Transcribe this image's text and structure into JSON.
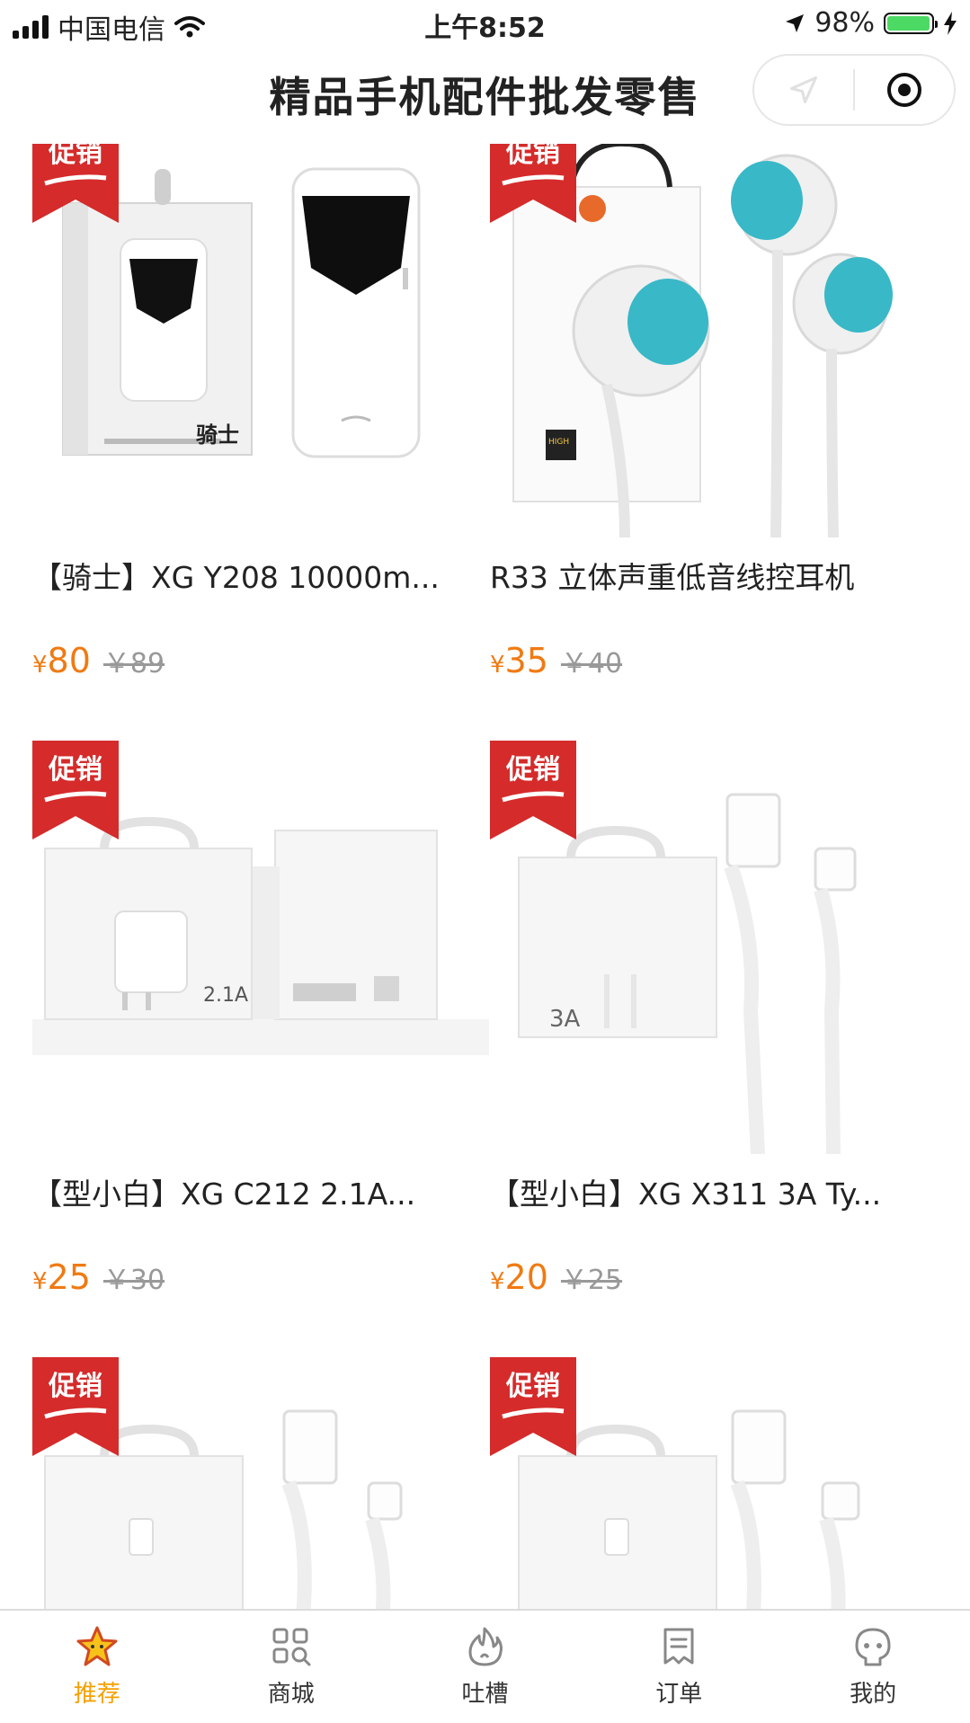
{
  "status_bar": {
    "carrier": "中国电信",
    "time": "上午8:52",
    "battery_percent": "98%",
    "battery_level": 0.98,
    "battery_color": "#4cd964"
  },
  "nav": {
    "title": "精品手机配件批发零售"
  },
  "promo_badge_text": "促销",
  "products": [
    {
      "title": "【骑士】XG Y208 10000m...",
      "currency": "¥",
      "price": "80",
      "original_price": "￥89",
      "image": "power-bank"
    },
    {
      "title": "R33 立体声重低音线控耳机",
      "currency": "¥",
      "price": "35",
      "original_price": "￥40",
      "image": "earphones"
    },
    {
      "title": "【型小白】XG C212 2.1A...",
      "currency": "¥",
      "price": "25",
      "original_price": "￥30",
      "image": "charger"
    },
    {
      "title": "【型小白】XG X311 3A Ty...",
      "currency": "¥",
      "price": "20",
      "original_price": "￥25",
      "image": "type-c-cable"
    },
    {
      "title": "",
      "currency": "",
      "price": "",
      "original_price": "",
      "image": "micro-usb-cable"
    },
    {
      "title": "",
      "currency": "",
      "price": "",
      "original_price": "",
      "image": "lightning-cable"
    }
  ],
  "image_texts": {
    "power_bank_brand": "骑士",
    "charger_rating": "2.1A",
    "cable_rating": "3A",
    "earphone_badge": "HIGH"
  },
  "tabs": [
    {
      "label": "推荐",
      "icon": "star-icon",
      "active": true
    },
    {
      "label": "商城",
      "icon": "grid-search-icon",
      "active": false
    },
    {
      "label": "吐槽",
      "icon": "flame-icon",
      "active": false
    },
    {
      "label": "订单",
      "icon": "order-list-icon",
      "active": false
    },
    {
      "label": "我的",
      "icon": "profile-face-icon",
      "active": false
    }
  ],
  "colors": {
    "accent": "#f07a12",
    "tab_active": "#f5a000",
    "promo_red": "#d52b2b",
    "earphone_teal": "#39b8c7"
  }
}
